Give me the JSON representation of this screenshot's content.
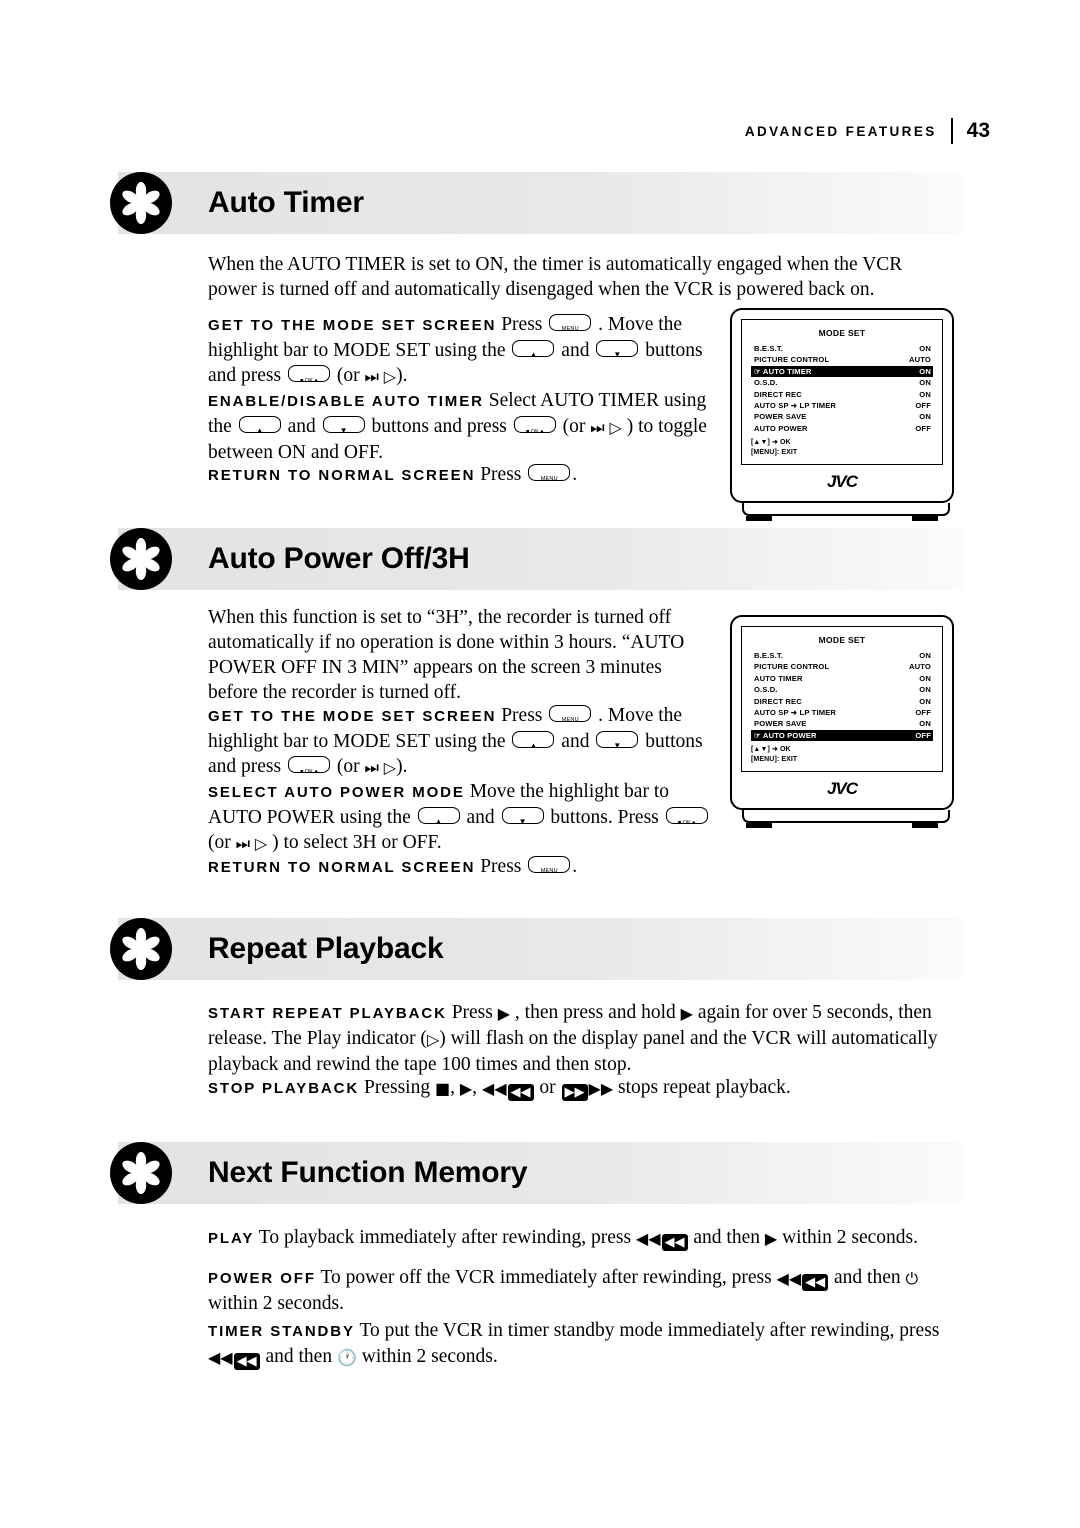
{
  "header": {
    "label": "ADVANCED FEATURES",
    "page": "43"
  },
  "sections": [
    {
      "title": "Auto Timer",
      "intro": "When the AUTO TIMER is set to ON, the timer is automatically engaged when the VCR power is turned off and automatically disengaged when the VCR is powered back on.",
      "steps": [
        {
          "label": "GET TO THE MODE SET SCREEN",
          "text_a": "Press",
          "text_b": ". Move the highlight bar to MODE SET using the",
          "text_c": "and",
          "text_d": "buttons and press",
          "text_e": "(or"
        },
        {
          "label": "ENABLE/DISABLE AUTO TIMER",
          "text_a": "Select AUTO TIMER using the",
          "text_b": "and",
          "text_c": "buttons and press",
          "text_d": "(or",
          "text_e": ") to toggle between ON and OFF."
        },
        {
          "label": "RETURN TO NORMAL SCREEN",
          "text_a": "Press"
        }
      ]
    },
    {
      "title": "Auto Power Off/3H",
      "intro": "When this function is set to “3H”, the recorder is turned off automatically if no operation is done within 3 hours. “AUTO POWER OFF IN 3 MIN” appears on the screen 3 minutes before the recorder is turned off.",
      "steps": [
        {
          "label": "GET TO THE MODE SET SCREEN",
          "text_a": "Press",
          "text_b": ". Move the highlight bar to MODE SET using the",
          "text_c": "and",
          "text_d": "buttons and press",
          "text_e": "(or"
        },
        {
          "label": "SELECT AUTO POWER MODE",
          "text_a": "Move the highlight bar to AUTO POWER using the",
          "text_b": "and",
          "text_c": "buttons. Press",
          "text_d": "(or",
          "text_e": ") to select 3H or OFF."
        },
        {
          "label": "RETURN TO NORMAL SCREEN",
          "text_a": "Press"
        }
      ]
    },
    {
      "title": "Repeat Playback",
      "steps": [
        {
          "label": "START REPEAT PLAYBACK",
          "text_a": "Press",
          "text_b": ", then press and hold",
          "text_c": "again for over 5 seconds, then release. The Play indicator (",
          "text_d": ") will flash on the display panel and the VCR will automatically playback and rewind the tape 100 times and then stop."
        },
        {
          "label": "STOP PLAYBACK",
          "text_a": "Pressing",
          "text_b": ",",
          "text_c": "or",
          "text_d": "stops repeat playback."
        }
      ]
    },
    {
      "title": "Next Function Memory",
      "steps": [
        {
          "label": "PLAY",
          "text_a": "To playback immediately after rewinding, press",
          "text_b": "and then",
          "text_c": "within 2 seconds."
        },
        {
          "label": "POWER OFF",
          "text_a": "To power off the VCR immediately after rewinding, press",
          "text_b": "and then",
          "text_c": "within 2 seconds."
        },
        {
          "label": "TIMER STANDBY",
          "text_a": "To put the VCR in timer standby mode immediately after rewinding, press",
          "text_b": "and then",
          "text_c": "within 2 seconds."
        }
      ]
    }
  ],
  "osd": {
    "title": "MODE SET",
    "footer_line1": "[▲▼] ➜ OK",
    "footer_line2": "[MENU]: EXIT",
    "brand": "JVC",
    "screen1": {
      "rows": [
        {
          "name": "B.E.S.T.",
          "value": "ON",
          "highlight": false,
          "cursor": false
        },
        {
          "name": "PICTURE CONTROL",
          "value": "AUTO",
          "highlight": false,
          "cursor": false
        },
        {
          "name": "AUTO TIMER",
          "value": "ON",
          "highlight": true,
          "cursor": true
        },
        {
          "name": "O.S.D.",
          "value": "ON",
          "highlight": false,
          "cursor": false
        },
        {
          "name": "DIRECT REC",
          "value": "ON",
          "highlight": false,
          "cursor": false
        },
        {
          "name": "AUTO SP ➜ LP TIMER",
          "value": "OFF",
          "highlight": false,
          "cursor": false
        },
        {
          "name": "POWER SAVE",
          "value": "ON",
          "highlight": false,
          "cursor": false
        },
        {
          "name": "AUTO POWER",
          "value": "OFF",
          "highlight": false,
          "cursor": false
        }
      ]
    },
    "screen2": {
      "rows": [
        {
          "name": "B.E.S.T.",
          "value": "ON",
          "highlight": false,
          "cursor": false
        },
        {
          "name": "PICTURE CONTROL",
          "value": "AUTO",
          "highlight": false,
          "cursor": false
        },
        {
          "name": "AUTO TIMER",
          "value": "ON",
          "highlight": false,
          "cursor": false
        },
        {
          "name": "O.S.D.",
          "value": "ON",
          "highlight": false,
          "cursor": false
        },
        {
          "name": "DIRECT REC",
          "value": "ON",
          "highlight": false,
          "cursor": false
        },
        {
          "name": "AUTO SP ➜ LP TIMER",
          "value": "OFF",
          "highlight": false,
          "cursor": false
        },
        {
          "name": "POWER SAVE",
          "value": "ON",
          "highlight": false,
          "cursor": false
        },
        {
          "name": "AUTO POWER",
          "value": "OFF",
          "highlight": true,
          "cursor": true
        }
      ]
    }
  }
}
